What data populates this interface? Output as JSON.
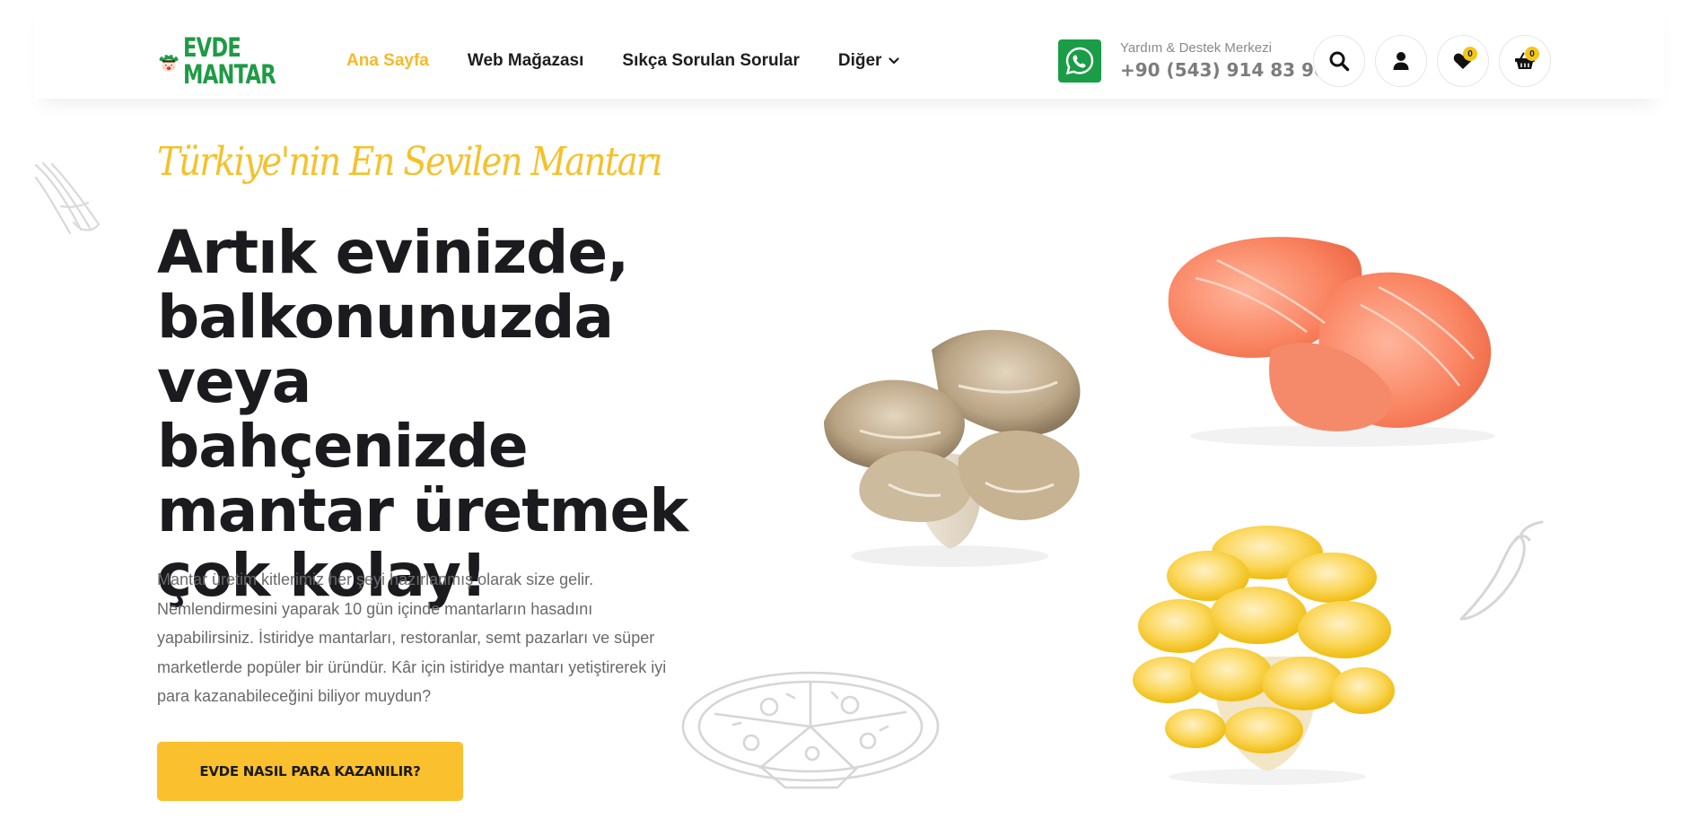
{
  "brand": {
    "logo_line1": "EVDE",
    "logo_line2": "MANTAR",
    "primary_color": "#1e9b45",
    "accent_color": "#fbc02d"
  },
  "nav": {
    "items": [
      {
        "label": "Ana Sayfa",
        "active": true
      },
      {
        "label": "Web Mağazası",
        "active": false
      },
      {
        "label": "Sıkça Sorulan Sorular",
        "active": false
      },
      {
        "label": "Diğer",
        "active": false,
        "has_dropdown": true
      }
    ]
  },
  "support": {
    "label": "Yardım & Destek Merkezi",
    "phone": "+90 (543) 914 83 90",
    "icon": "whatsapp-icon"
  },
  "actions": {
    "search_icon": "search-icon",
    "account_icon": "user-icon",
    "wishlist_icon": "heart-icon",
    "wishlist_count": "0",
    "cart_icon": "basket-icon",
    "cart_count": "0"
  },
  "hero": {
    "script_heading": "Türkiye'nin En Sevilen Mantarı",
    "title": "Artık evinizde, balkonunuzda veya bahçenizde mantar üretmek çok kolay!",
    "description": "Mantar üretim kitlerimiz her şeyi hazırlanmış olarak size gelir. Nemlendirmesini yaparak 10 gün içinde mantarların hasadını yapabilirsiniz. İstiridye mantarları, restoranlar, semt pazarları ve süper marketlerde popüler bir üründür. Kâr için istiridye mantarı yetiştirerek iyi para kazanabileceğini biliyor muydun?",
    "cta_label": "EVDE NASIL PARA KAZANILIR?"
  }
}
